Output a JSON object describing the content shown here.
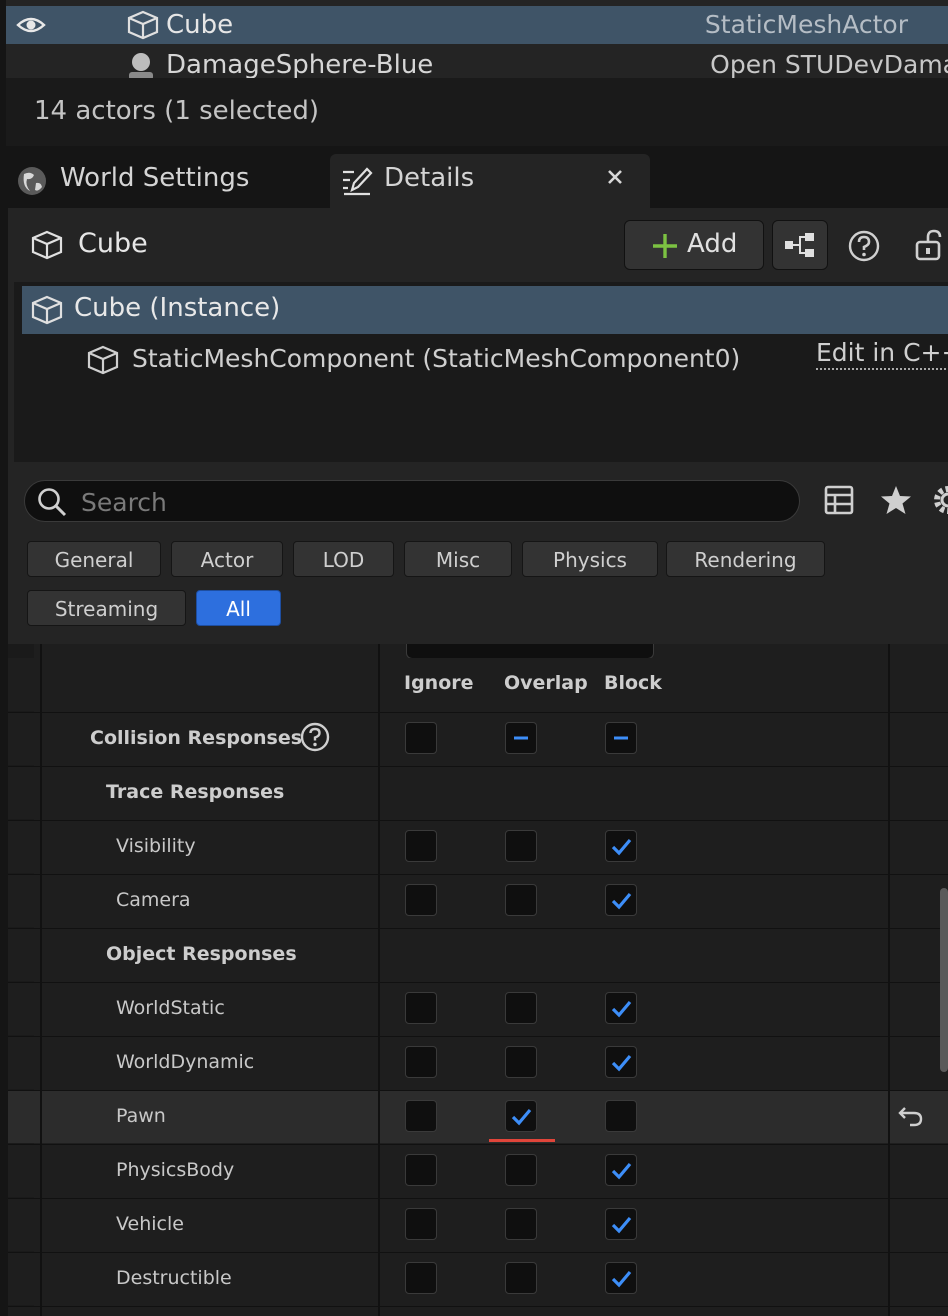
{
  "outliner": {
    "rows": [
      {
        "label": "Cube",
        "type": "StaticMeshActor"
      },
      {
        "label": "DamageSphere-Blue",
        "type": "Open STUDevDama"
      }
    ],
    "status": "14 actors (1 selected)"
  },
  "tabs": [
    {
      "label": "World Settings"
    },
    {
      "label": "Details"
    }
  ],
  "details": {
    "actor_name": "Cube",
    "add_label": "Add",
    "components": [
      {
        "label": "Cube (Instance)"
      },
      {
        "label": "StaticMeshComponent (StaticMeshComponent0)"
      }
    ],
    "edit_link": "Edit in C++",
    "search": {
      "placeholder": "Search",
      "value": ""
    },
    "filters": [
      "General",
      "Actor",
      "LOD",
      "Misc",
      "Physics",
      "Rendering",
      "Streaming",
      "All"
    ],
    "active_filter": "All"
  },
  "collision": {
    "columns": [
      "Ignore",
      "Overlap",
      "Block"
    ],
    "header": {
      "label": "Collision Responses",
      "states": [
        "empty",
        "mixed",
        "mixed"
      ]
    },
    "trace_header": "Trace Responses",
    "trace": [
      {
        "label": "Visibility",
        "states": [
          "empty",
          "empty",
          "checked"
        ]
      },
      {
        "label": "Camera",
        "states": [
          "empty",
          "empty",
          "checked"
        ]
      }
    ],
    "object_header": "Object Responses",
    "object": [
      {
        "label": "WorldStatic",
        "states": [
          "empty",
          "empty",
          "checked"
        ]
      },
      {
        "label": "WorldDynamic",
        "states": [
          "empty",
          "empty",
          "checked"
        ]
      },
      {
        "label": "Pawn",
        "states": [
          "empty",
          "checked",
          "empty"
        ],
        "modified": true
      },
      {
        "label": "PhysicsBody",
        "states": [
          "empty",
          "empty",
          "checked"
        ]
      },
      {
        "label": "Vehicle",
        "states": [
          "empty",
          "empty",
          "checked"
        ]
      },
      {
        "label": "Destructible",
        "states": [
          "empty",
          "empty",
          "checked"
        ]
      }
    ]
  },
  "colors": {
    "selection": "#3f5467",
    "accent": "#2d6fde",
    "check": "#3d8ef8",
    "modified": "#e0453a"
  }
}
